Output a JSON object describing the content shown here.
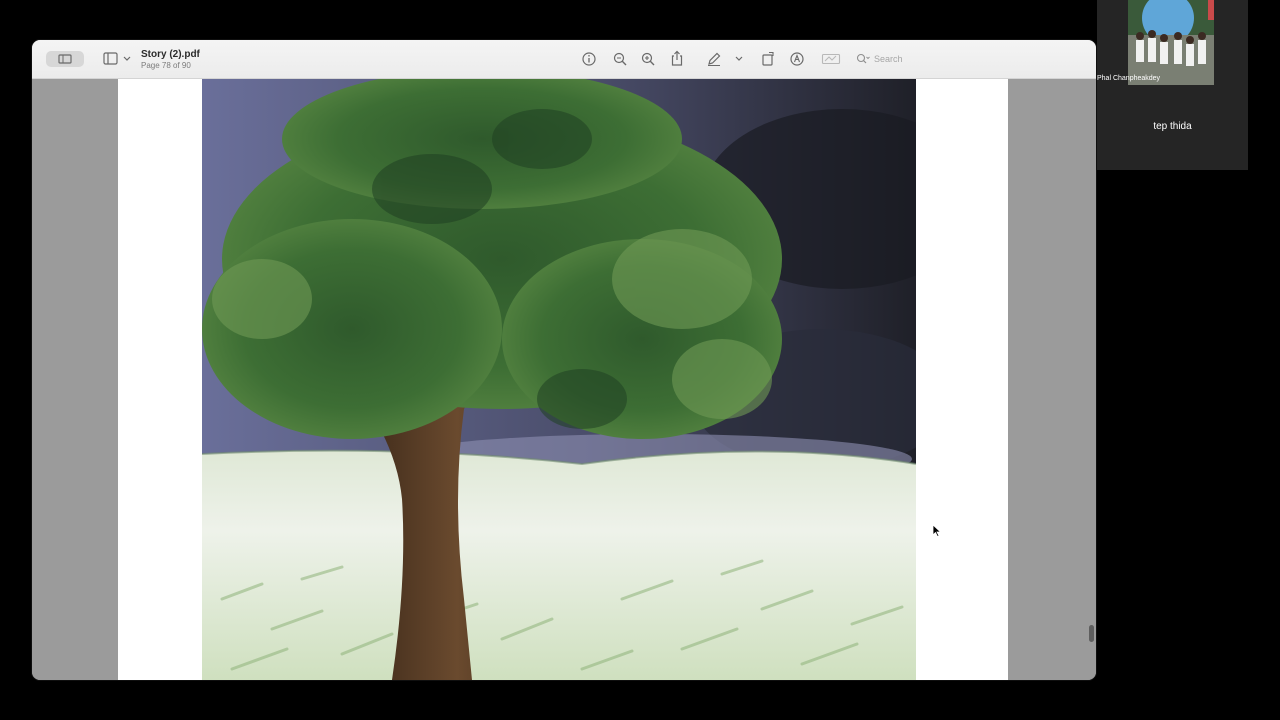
{
  "window": {
    "title": "Story (2).pdf",
    "page_info": "Page 78 of 90"
  },
  "toolbar": {
    "search_placeholder": "Search",
    "icons": [
      "sidebar-toggle-icon",
      "info-icon",
      "zoom-out-icon",
      "zoom-in-icon",
      "share-icon",
      "markup-pen-icon",
      "chevron-down-icon",
      "rotate-icon",
      "markup-circle-icon",
      "signature-icon",
      "search-icon"
    ]
  },
  "call": {
    "participant_name": "Phal Chanpheakdey",
    "self_name": "tep thida"
  },
  "colors": {
    "toolbar_bg": "#ececec",
    "content_bg": "#9b9b9b",
    "call_panel_bg": "#252525"
  }
}
